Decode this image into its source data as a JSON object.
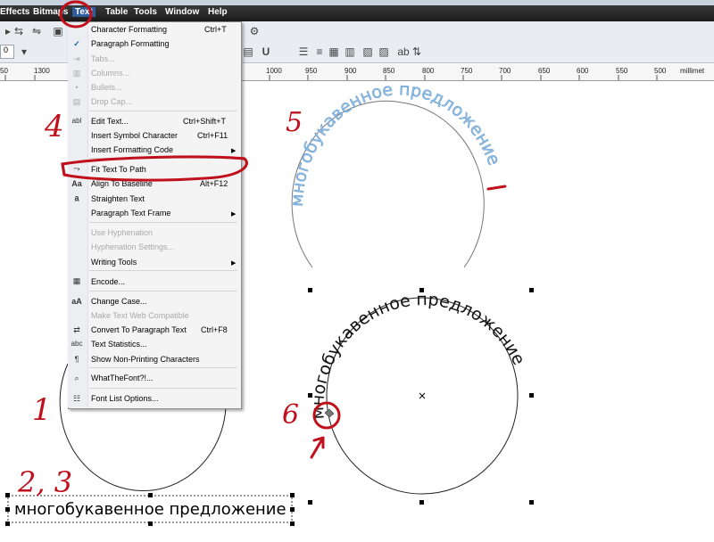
{
  "menubar": {
    "items": [
      "Effects",
      "Bitmaps",
      "Text",
      "Table",
      "Tools",
      "Window",
      "Help"
    ]
  },
  "toolbar": {
    "zoom_value": "0"
  },
  "ruler": {
    "ticks": [
      "50",
      "1300",
      "1000",
      "950",
      "900",
      "850",
      "800",
      "750",
      "700",
      "650",
      "600",
      "550",
      "500",
      "millimet"
    ]
  },
  "text_menu": {
    "items": [
      {
        "label": "Character Formatting",
        "shortcut": "Ctrl+T",
        "disabled": false,
        "icon": "char-format-icon"
      },
      {
        "label": "Paragraph Formatting",
        "shortcut": "",
        "disabled": false,
        "icon": "checkmark-icon"
      },
      {
        "label": "Tabs...",
        "shortcut": "",
        "disabled": true,
        "icon": "tabs-icon"
      },
      {
        "label": "Columns...",
        "shortcut": "",
        "disabled": true,
        "icon": "columns-icon"
      },
      {
        "label": "Bullets...",
        "shortcut": "",
        "disabled": true,
        "icon": "bullets-icon"
      },
      {
        "label": "Drop Cap...",
        "shortcut": "",
        "disabled": true,
        "icon": "drop-cap-icon"
      },
      {
        "label": "Edit Text...",
        "shortcut": "Ctrl+Shift+T",
        "disabled": false,
        "icon": "edit-text-icon"
      },
      {
        "label": "Insert Symbol Character",
        "shortcut": "Ctrl+F11",
        "disabled": false,
        "icon": ""
      },
      {
        "label": "Insert Formatting Code",
        "shortcut": "",
        "disabled": false,
        "icon": "",
        "submenu": true
      },
      {
        "label": "Fit Text To Path",
        "shortcut": "",
        "disabled": false,
        "icon": "fit-text-path-icon"
      },
      {
        "label": "Align To Baseline",
        "shortcut": "Alt+F12",
        "disabled": false,
        "icon": "align-baseline-icon"
      },
      {
        "label": "Straighten Text",
        "shortcut": "",
        "disabled": false,
        "icon": "straighten-text-icon"
      },
      {
        "label": "Paragraph Text Frame",
        "shortcut": "",
        "disabled": false,
        "icon": "",
        "submenu": true
      },
      {
        "label": "Use Hyphenation",
        "shortcut": "",
        "disabled": true,
        "icon": ""
      },
      {
        "label": "Hyphenation Settings...",
        "shortcut": "",
        "disabled": true,
        "icon": ""
      },
      {
        "label": "Writing Tools",
        "shortcut": "",
        "disabled": false,
        "icon": "",
        "submenu": true
      },
      {
        "label": "Encode...",
        "shortcut": "",
        "disabled": false,
        "icon": "encode-icon"
      },
      {
        "label": "Change Case...",
        "shortcut": "",
        "disabled": false,
        "icon": "change-case-icon"
      },
      {
        "label": "Make Text Web Compatible",
        "shortcut": "",
        "disabled": true,
        "icon": ""
      },
      {
        "label": "Convert To Paragraph Text",
        "shortcut": "Ctrl+F8",
        "disabled": false,
        "icon": "convert-text-icon"
      },
      {
        "label": "Text Statistics...",
        "shortcut": "",
        "disabled": false,
        "icon": "text-stats-icon"
      },
      {
        "label": "Show Non-Printing Characters",
        "shortcut": "",
        "disabled": false,
        "icon": "pilcrow-icon"
      },
      {
        "label": "WhatTheFont?!...",
        "shortcut": "",
        "disabled": false,
        "icon": "whatthefont-icon"
      },
      {
        "label": "Font List Options...",
        "shortcut": "",
        "disabled": false,
        "icon": "font-list-icon"
      }
    ]
  },
  "canvas": {
    "sample_text": "многобукавенное предложение",
    "arc_text_blue": "многобукавенное предложение",
    "arc_text_black": "многобукавенное предложение"
  },
  "annotations": {
    "step_4": "4",
    "step_5": "5",
    "step_1": "1",
    "step_2_3": "2, 3",
    "step_6": "6"
  },
  "colors": {
    "menubar": "#222222",
    "menu_active": "#2f5c9a",
    "annotation_red": "#c0101c",
    "arc_text_blue": "#8fbde6",
    "menu_bg": "#f4f4f4"
  }
}
